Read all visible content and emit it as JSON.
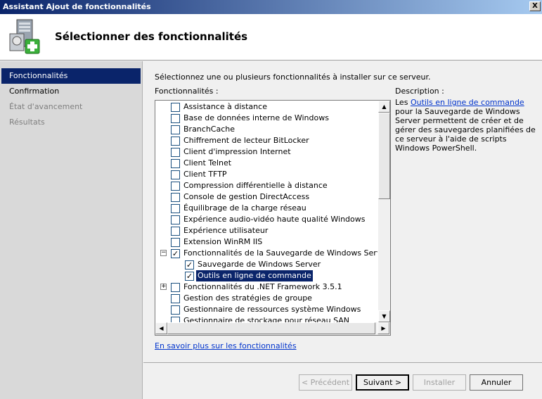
{
  "window": {
    "title": "Assistant Ajout de fonctionnalités",
    "close_label": "X"
  },
  "header": {
    "title": "Sélectionner des fonctionnalités",
    "icon": "server-add-icon"
  },
  "sidebar": {
    "items": [
      {
        "label": "Fonctionnalités",
        "state": "active"
      },
      {
        "label": "Confirmation",
        "state": "normal"
      },
      {
        "label": "État d'avancement",
        "state": "disabled"
      },
      {
        "label": "Résultats",
        "state": "disabled"
      }
    ]
  },
  "main": {
    "intro": "Sélectionnez une ou plusieurs fonctionnalités à installer sur ce serveur.",
    "features_label": "Fonctionnalités :",
    "description_label": "Description :",
    "description": {
      "prefix": "Les ",
      "link": "Outils en ligne de commande",
      "suffix": " pour la Sauvegarde de Windows Server permettent de créer et de gérer des sauvegardes planifiées de ce serveur à l'aide de scripts Windows PowerShell."
    },
    "features": [
      {
        "label": "Assistance à distance",
        "checked": false
      },
      {
        "label": "Base de données interne de Windows",
        "checked": false
      },
      {
        "label": "BranchCache",
        "checked": false
      },
      {
        "label": "Chiffrement de lecteur BitLocker",
        "checked": false
      },
      {
        "label": "Client d'impression Internet",
        "checked": false
      },
      {
        "label": "Client Telnet",
        "checked": false
      },
      {
        "label": "Client TFTP",
        "checked": false
      },
      {
        "label": "Compression différentielle à distance",
        "checked": false
      },
      {
        "label": "Console de gestion DirectAccess",
        "checked": false
      },
      {
        "label": "Équilibrage de la charge réseau",
        "checked": false
      },
      {
        "label": "Expérience audio-vidéo haute qualité Windows",
        "checked": false
      },
      {
        "label": "Expérience utilisateur",
        "checked": false
      },
      {
        "label": "Extension WinRM IIS",
        "checked": false
      },
      {
        "label": "Fonctionnalités de la Sauvegarde de Windows Server",
        "checked": true,
        "expander": "−"
      },
      {
        "label": "Sauvegarde de Windows Server",
        "checked": true,
        "child": true
      },
      {
        "label": "Outils en ligne de commande",
        "checked": true,
        "child": true,
        "selected": true
      },
      {
        "label": "Fonctionnalités du .NET Framework 3.5.1",
        "checked": false,
        "expander": "+"
      },
      {
        "label": "Gestion des stratégies de groupe",
        "checked": false
      },
      {
        "label": "Gestionnaire de ressources système Windows",
        "checked": false
      },
      {
        "label": "Gestionnaire de stockage pour réseau SAN",
        "checked": false
      }
    ],
    "check_mark": "✓",
    "scroll_up": "▲",
    "scroll_down": "▼",
    "scroll_left": "◀",
    "scroll_right": "▶",
    "more_link": "En savoir plus sur les fonctionnalités"
  },
  "buttons": {
    "previous": "< Précédent",
    "next": "Suivant >",
    "install": "Installer",
    "cancel": "Annuler"
  },
  "colors": {
    "selection": "#0a246a",
    "link": "#0033cc"
  }
}
